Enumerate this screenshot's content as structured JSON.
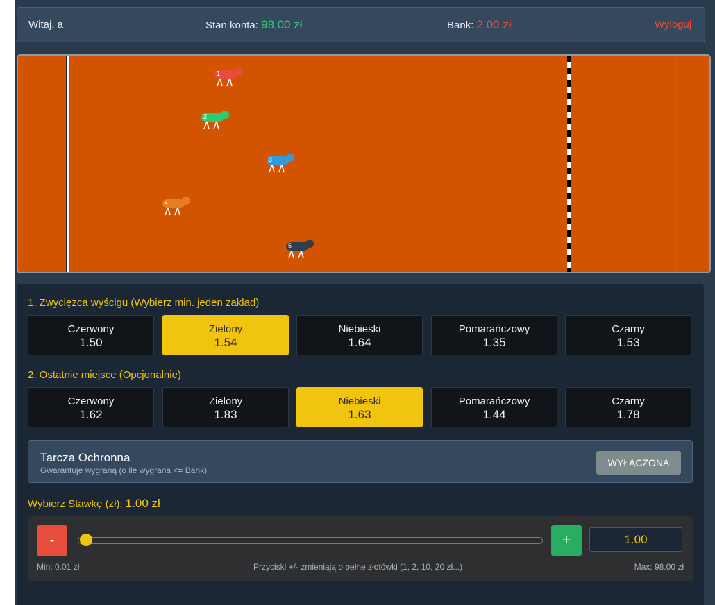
{
  "header": {
    "greeting": "Witaj, a",
    "balance_label": "Stan konta:",
    "balance_value": "98.00 zł",
    "bank_label": "Bank:",
    "bank_value": "2.00 zł",
    "logout_label": "Wyloguj"
  },
  "race": {
    "runners": [
      {
        "number": "1",
        "color": "#e74c3c",
        "progress": 0.3
      },
      {
        "number": "2",
        "color": "#2ecc71",
        "progress": 0.28
      },
      {
        "number": "3",
        "color": "#3498db",
        "progress": 0.38
      },
      {
        "number": "4",
        "color": "#e67e22",
        "progress": 0.22
      },
      {
        "number": "5",
        "color": "#2c3e50",
        "progress": 0.41
      }
    ]
  },
  "winner_section": {
    "title": "1. Zwycięzca wyścigu (Wybierz min. jeden zakład)",
    "options": [
      {
        "name": "Czerwony",
        "odds": "1.50",
        "selected": false
      },
      {
        "name": "Zielony",
        "odds": "1.54",
        "selected": true
      },
      {
        "name": "Niebieski",
        "odds": "1.64",
        "selected": false
      },
      {
        "name": "Pomarańczowy",
        "odds": "1.35",
        "selected": false
      },
      {
        "name": "Czarny",
        "odds": "1.53",
        "selected": false
      }
    ]
  },
  "last_section": {
    "title": "2. Ostatnie miejsce (Opcjonalnie)",
    "options": [
      {
        "name": "Czerwony",
        "odds": "1.62",
        "selected": false
      },
      {
        "name": "Zielony",
        "odds": "1.83",
        "selected": false
      },
      {
        "name": "Niebieski",
        "odds": "1.63",
        "selected": true
      },
      {
        "name": "Pomarańczowy",
        "odds": "1.44",
        "selected": false
      },
      {
        "name": "Czarny",
        "odds": "1.78",
        "selected": false
      }
    ]
  },
  "shield": {
    "title": "Tarcza Ochronna",
    "description": "Gwarantuje wygraną (o ile wygrana <= Bank)",
    "button_label": "WYŁĄCZONA"
  },
  "stake": {
    "label": "Wybierz Stawkę (zł):",
    "current": "1.00 zł",
    "minus_label": "-",
    "plus_label": "+",
    "input_value": "1.00",
    "slider_level": 0.0,
    "min_label": "Min: 0.01 zł",
    "hint": "Przyciski +/- zmieniają o pełne złotówki (1, 2, 10, 20 zł...)",
    "max_label": "Max: 98.00 zł"
  }
}
